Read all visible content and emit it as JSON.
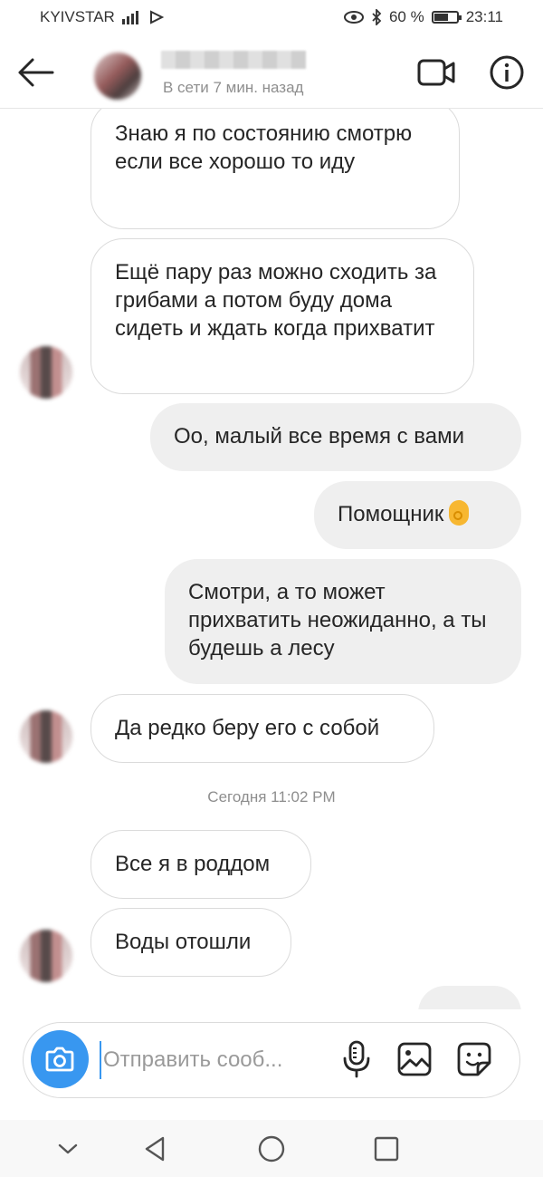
{
  "status_bar": {
    "carrier": "KYIVSTAR",
    "battery_percent": "60 %",
    "time": "23:11"
  },
  "header": {
    "status": "В сети 7 мин. назад",
    "icons": [
      "back-arrow-icon",
      "video-call-icon",
      "info-icon"
    ]
  },
  "messages": [
    {
      "direction": "in",
      "text": "Знаю я по состоянию смотрю если все хорошо то иду"
    },
    {
      "direction": "in",
      "text": "Ещё пару раз можно сходить за грибами а потом буду дома сидеть и ждать когда прихватит"
    },
    {
      "direction": "out",
      "text": "Оо, малый все время с вами"
    },
    {
      "direction": "out",
      "text": "Помощник",
      "emoji": "ok-hand-emoji"
    },
    {
      "direction": "out",
      "text": "Смотри, а то может прихватить неожиданно, а ты будешь а лесу"
    },
    {
      "direction": "in",
      "text": "Да редко беру его с собой"
    },
    {
      "direction": "in",
      "text": "Все я в роддом"
    },
    {
      "direction": "in",
      "text": "Воды отошли"
    }
  ],
  "timestamp": "Сегодня 11:02 PM",
  "composer": {
    "placeholder": "Отправить сооб...",
    "icons": [
      "camera-icon",
      "microphone-icon",
      "gallery-icon",
      "sticker-icon"
    ]
  },
  "colors": {
    "accent": "#3897f0",
    "outgoing_bubble": "#efefef",
    "incoming_border": "#dbdbdb"
  }
}
